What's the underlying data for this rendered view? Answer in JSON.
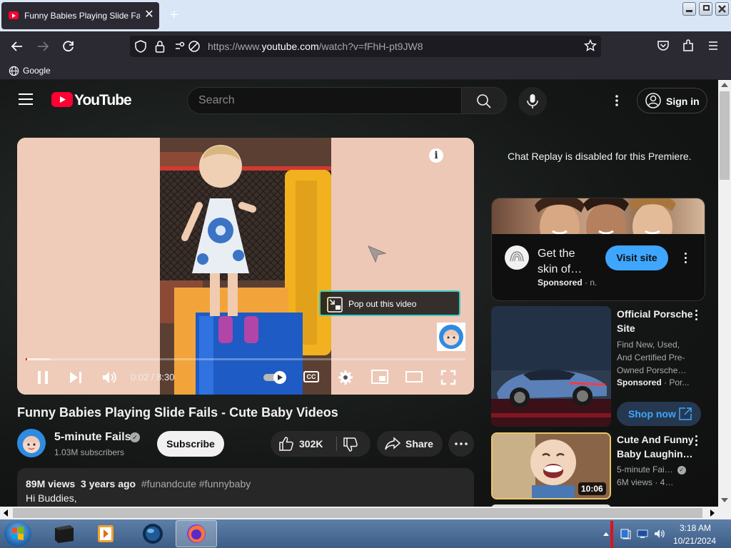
{
  "browser": {
    "tab_title": "Funny Babies Playing Slide Fails",
    "url_prefix": "https://www.",
    "url_domain": "youtube.com",
    "url_path": "/watch?v=fFhH-pt9JW8",
    "bookmark_google": "Google"
  },
  "masthead": {
    "logo_text": "YouTube",
    "search_placeholder": "Search",
    "sign_in_label": "Sign in"
  },
  "player": {
    "popout_label": "Pop out this video",
    "time_current": "0:02",
    "time_separator": " / ",
    "time_total": "8:30",
    "progress_fraction": 0.004,
    "buffered_fraction": 0.055,
    "cc_label": "CC"
  },
  "video": {
    "title": "Funny Babies Playing Slide Fails - Cute Baby Videos",
    "channel_name": "5-minute Fails",
    "subscribers": "1.03M subscribers",
    "subscribe_label": "Subscribe",
    "likes": "302K",
    "share_label": "Share",
    "views": "89M views",
    "age": "3 years ago",
    "tags": "#funandcute #funnybaby",
    "description_first_line": "Hi Buddies,"
  },
  "sidebar": {
    "chat_message": "Chat Replay is disabled for this Premiere.",
    "ad": {
      "title": "Get the skin of…",
      "sponsored": "Sponsored",
      "sponsor_suffix": " · n.",
      "cta": "Visit site"
    },
    "porsche": {
      "title": "Official Porsche Site",
      "description": "Find New, Used, And Certified Pre-Owned Porsche…",
      "sponsored": "Sponsored",
      "sponsor_suffix": " · Por...",
      "cta": "Shop now"
    },
    "baby_video": {
      "title": "Cute And Funny Baby Laughin…",
      "channel": "5-minute Fai…",
      "stats": "6M views · 4…",
      "duration": "10:06"
    }
  },
  "taskbar": {
    "time": "3:18 AM",
    "date": "10/21/2024"
  },
  "colors": {
    "youtube_red": "#ff0033",
    "accent_blue": "#3ea6ff",
    "progress_red": "#ff0000"
  }
}
